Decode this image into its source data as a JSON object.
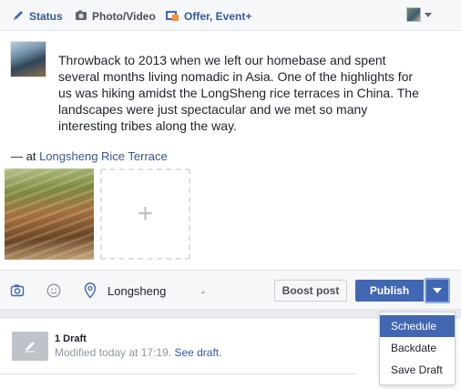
{
  "composer": {
    "tabs": [
      {
        "label": "Status",
        "icon": "pencil-icon"
      },
      {
        "label": "Photo/Video",
        "icon": "camera-icon"
      },
      {
        "label": "Offer, Event+",
        "icon": "calendar-icon"
      }
    ],
    "post_text": "Throwback to 2013 when we left our homebase and spent several months living nomadic in Asia. One of the highlights for us was hiking amidst the LongSheng rice terraces in China. The landscapes were just spectacular and we met so many interesting tribes along the way.",
    "location_prefix": "— at ",
    "location_link": "Longsheng Rice Terrace",
    "add_photo_glyph": "+"
  },
  "action_bar": {
    "location_value": "Longsheng",
    "boost_label": "Boost post",
    "publish_label": "Publish"
  },
  "publish_menu": {
    "items": [
      "Schedule",
      "Backdate",
      "Save Draft"
    ],
    "active_index": 0
  },
  "drafts": {
    "title": "1 Draft",
    "modified": "Modified today at 17:19.",
    "see_link": "See draft."
  },
  "colors": {
    "link": "#365899",
    "primary_button": "#4267b2",
    "background": "#f6f7f9"
  }
}
